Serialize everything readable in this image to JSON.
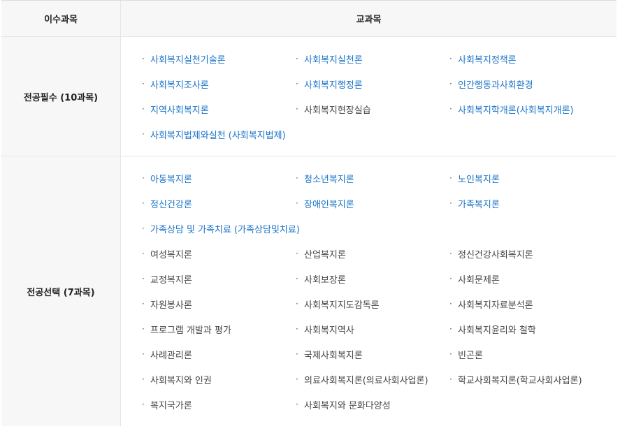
{
  "header": {
    "col1": "이수과목",
    "col2": "교과목"
  },
  "bullet": "·",
  "sections": [
    {
      "label": "전공필수 (10과목)",
      "items": [
        {
          "text": "사회복지실천기술론",
          "link": true
        },
        {
          "text": "사회복지실천론",
          "link": true
        },
        {
          "text": "사회복지정책론",
          "link": true
        },
        {
          "text": "사회복지조사론",
          "link": true
        },
        {
          "text": "사회복지행정론",
          "link": true
        },
        {
          "text": "인간행동과사회환경",
          "link": true
        },
        {
          "text": "지역사회복지론",
          "link": true
        },
        {
          "text": "사회복지현장실습",
          "link": false
        },
        {
          "text": "사회복지학개론(사회복지개론)",
          "link": true
        },
        {
          "text": "사회복지법제와실천 (사회복지법제)",
          "link": true
        }
      ]
    },
    {
      "label": "전공선택 (7과목)",
      "items": [
        {
          "text": "아동복지론",
          "link": true
        },
        {
          "text": "청소년복지론",
          "link": true
        },
        {
          "text": "노인복지론",
          "link": true
        },
        {
          "text": "정신건강론",
          "link": true
        },
        {
          "text": "장애인복지론",
          "link": true
        },
        {
          "text": "가족복지론",
          "link": true
        },
        {
          "text": "가족상담 및 가족치료 (가족상담및치료)",
          "link": true,
          "full": true
        },
        {
          "text": "여성복지론",
          "link": false
        },
        {
          "text": "산업복지론",
          "link": false
        },
        {
          "text": "정신건강사회복지론",
          "link": false
        },
        {
          "text": "교정복지론",
          "link": false
        },
        {
          "text": "사회보장론",
          "link": false
        },
        {
          "text": "사회문제론",
          "link": false
        },
        {
          "text": "자원봉사론",
          "link": false
        },
        {
          "text": "사회복지지도감독론",
          "link": false
        },
        {
          "text": "사회복지자료분석론",
          "link": false
        },
        {
          "text": "프로그램 개발과 평가",
          "link": false
        },
        {
          "text": "사회복지역사",
          "link": false
        },
        {
          "text": "사회복지윤리와 철학",
          "link": false
        },
        {
          "text": "사례관리론",
          "link": false
        },
        {
          "text": "국제사회복지론",
          "link": false
        },
        {
          "text": "빈곤론",
          "link": false
        },
        {
          "text": "사회복지와 인권",
          "link": false
        },
        {
          "text": "의료사회복지론(의료사회사업론)",
          "link": false
        },
        {
          "text": "학교사회복지론(학교사회사업론)",
          "link": false
        },
        {
          "text": "복지국가론",
          "link": false
        },
        {
          "text": "사회복지와 문화다양성",
          "link": false
        }
      ]
    }
  ],
  "colors": {
    "link": "#1a73c8",
    "text": "#444444",
    "header_bg": "#f7f7f7"
  }
}
